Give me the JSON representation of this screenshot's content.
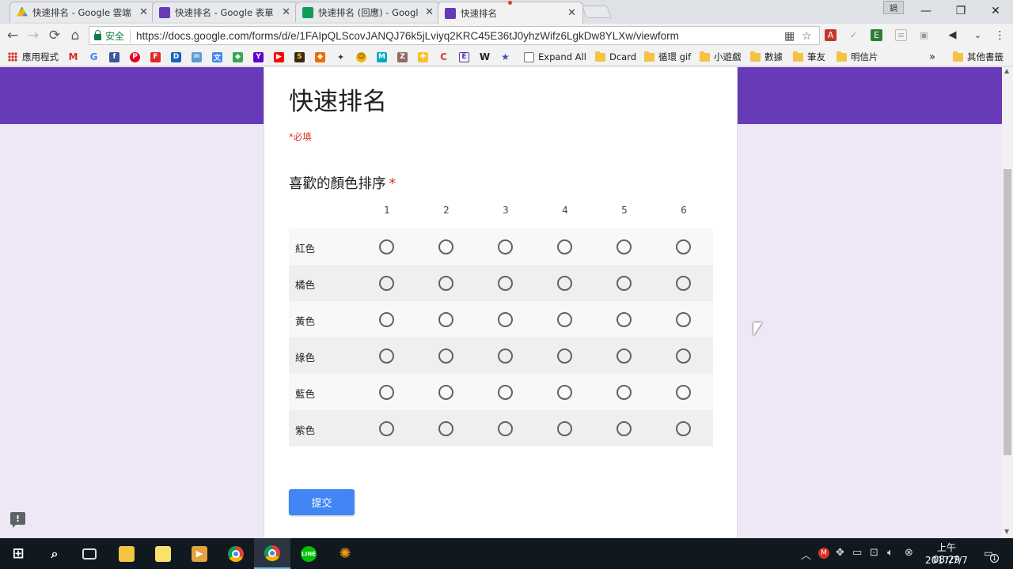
{
  "tabs": [
    {
      "title": "快速排名 - Google 雲端",
      "icon": "drive-icon",
      "active": false
    },
    {
      "title": "快速排名 - Google 表單",
      "icon": "forms-icon",
      "active": false
    },
    {
      "title": "快速排名 (回應) - Googl",
      "icon": "sheets-icon",
      "active": false
    },
    {
      "title": "快速排名",
      "icon": "forms-icon",
      "active": true
    }
  ],
  "window": {
    "user_badge": "鍋",
    "minimize": "—",
    "restore": "❐",
    "close": "✕"
  },
  "omnibox": {
    "secure_label": "安全",
    "url": "https://docs.google.com/forms/d/e/1FAIpQLScovJANQJ76k5jLviyq2KRC45E36tJ0yhzWifz6LgkDw8YLXw/viewform"
  },
  "bookmarks": {
    "apps": "應用程式",
    "expand_all": "Expand All",
    "folders": [
      "Dcard",
      "循環 gif",
      "小遊戲",
      "數據",
      "筆友",
      "明信片"
    ],
    "overflow": "»",
    "other": "其他書籤"
  },
  "form": {
    "title": "快速排名",
    "required_note": "*必填",
    "question": "喜歡的顏色排序",
    "required_star": "*",
    "columns": [
      "1",
      "2",
      "3",
      "4",
      "5",
      "6"
    ],
    "rows": [
      "紅色",
      "橘色",
      "黃色",
      "綠色",
      "藍色",
      "紫色"
    ],
    "submit_label": "提交"
  },
  "taskbar": {
    "time": "上午 08:29",
    "date": "2017/7/7",
    "notifications": "1"
  },
  "colors": {
    "form_accent": "#673ab7",
    "page_bg": "#ede7f6",
    "submit": "#4285f4",
    "required": "#d93025"
  }
}
